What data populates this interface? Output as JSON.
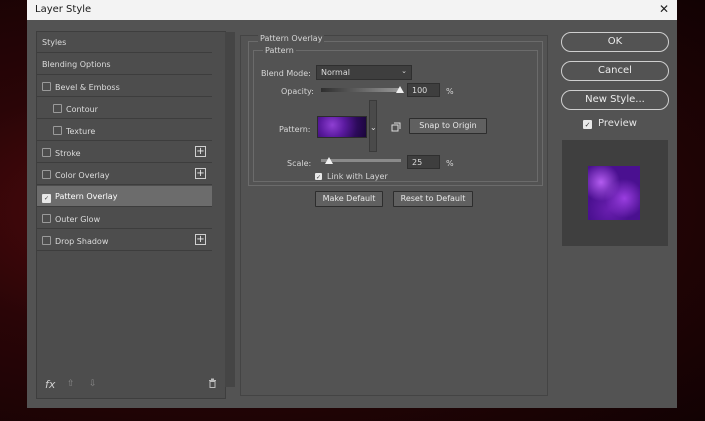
{
  "window": {
    "title": "Layer Style",
    "close_glyph": "✕"
  },
  "left_panel": {
    "items": [
      {
        "label": "Styles",
        "checkbox": false,
        "checked": false,
        "plus": false,
        "sub": false
      },
      {
        "label": "Blending Options",
        "checkbox": false,
        "checked": false,
        "plus": false,
        "sub": false
      },
      {
        "label": "Bevel & Emboss",
        "checkbox": true,
        "checked": false,
        "plus": false,
        "sub": false
      },
      {
        "label": "Contour",
        "checkbox": true,
        "checked": false,
        "plus": false,
        "sub": true
      },
      {
        "label": "Texture",
        "checkbox": true,
        "checked": false,
        "plus": false,
        "sub": true
      },
      {
        "label": "Stroke",
        "checkbox": true,
        "checked": false,
        "plus": true,
        "sub": false
      },
      {
        "label": "Color Overlay",
        "checkbox": true,
        "checked": false,
        "plus": true,
        "sub": false
      },
      {
        "label": "Pattern Overlay",
        "checkbox": true,
        "checked": true,
        "plus": false,
        "sub": false,
        "selected": true
      },
      {
        "label": "Outer Glow",
        "checkbox": true,
        "checked": false,
        "plus": false,
        "sub": false
      },
      {
        "label": "Drop Shadow",
        "checkbox": true,
        "checked": false,
        "plus": true,
        "sub": false
      }
    ],
    "footer": {
      "fx": "fx",
      "up": "⇧",
      "down": "⇩",
      "trash": "🗑"
    }
  },
  "pattern_overlay": {
    "section_title": "Pattern Overlay",
    "group_title": "Pattern",
    "blend_mode_label": "Blend Mode:",
    "blend_mode_value": "Normal",
    "opacity_label": "Opacity:",
    "opacity_value": "100",
    "percent": "%",
    "pattern_label": "Pattern:",
    "snap_button": "Snap to Origin",
    "scale_label": "Scale:",
    "scale_value": "25",
    "link_label": "Link with Layer",
    "link_checked": true,
    "make_default": "Make Default",
    "reset_default": "Reset to Default"
  },
  "right_panel": {
    "ok": "OK",
    "cancel": "Cancel",
    "new_style": "New Style...",
    "preview_label": "Preview",
    "preview_checked": true
  },
  "colors": {
    "dialog_bg": "#535353",
    "accent_purple": "#8e3fd2"
  }
}
